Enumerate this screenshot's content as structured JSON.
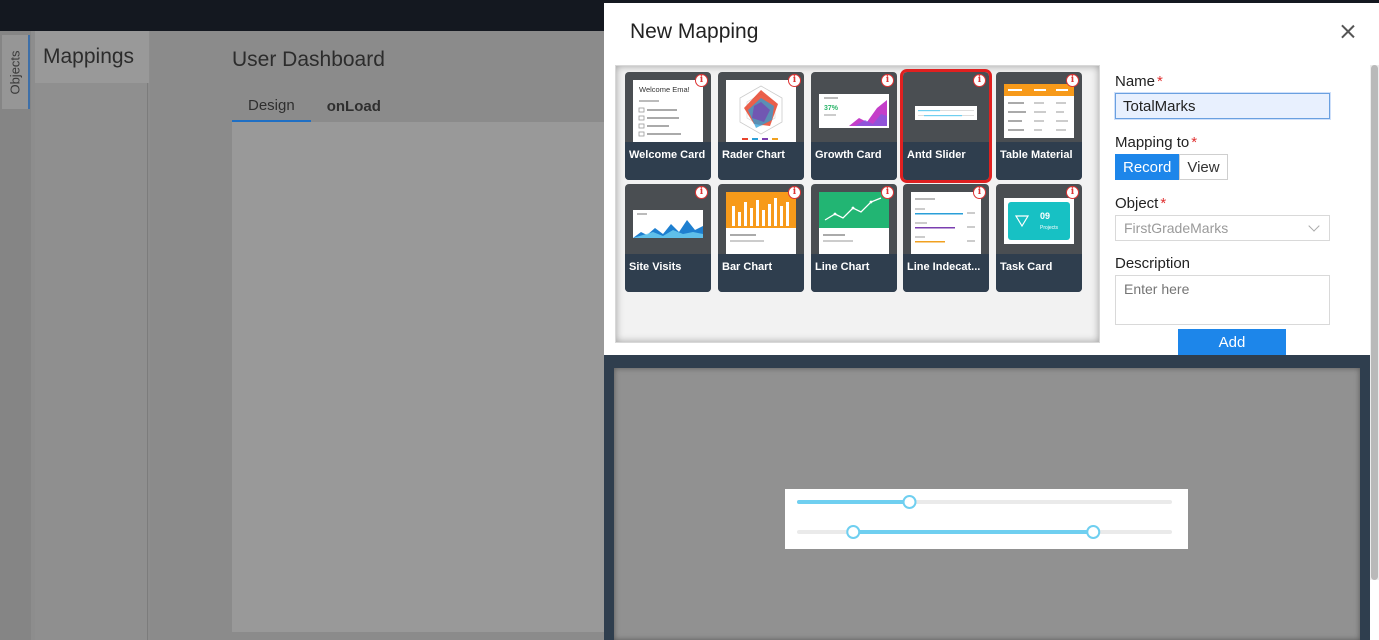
{
  "sidebar": {
    "tab_label": "Objects"
  },
  "panel": {
    "title": "Mappings"
  },
  "dashboard": {
    "title": "User Dashboard",
    "tabs": [
      {
        "label": "Design"
      },
      {
        "label": "onLoad"
      }
    ]
  },
  "modal": {
    "title": "New Mapping",
    "close_icon": "close-icon",
    "templates": [
      {
        "label": "Welcome Card",
        "thumb_title": "Welcome Ema!"
      },
      {
        "label": "Rader Chart"
      },
      {
        "label": "Growth Card",
        "thumb_value": "37%"
      },
      {
        "label": "Antd Slider",
        "selected": true
      },
      {
        "label": "Table Material"
      },
      {
        "label": "Site Visits"
      },
      {
        "label": "Bar Chart"
      },
      {
        "label": "Line Chart"
      },
      {
        "label": "Line Indecat..."
      },
      {
        "label": "Task Card",
        "thumb_value": "09",
        "thumb_sub": "Projects"
      }
    ],
    "form": {
      "name_label": "Name",
      "name_value": "TotalMarks",
      "mapping_label": "Mapping to",
      "mapping_options": [
        {
          "label": "Record",
          "selected": true
        },
        {
          "label": "View"
        }
      ],
      "object_label": "Object",
      "object_value": "FirstGradeMarks",
      "description_label": "Description",
      "description_placeholder": "Enter here",
      "required_mark": "*",
      "add_label": "Add"
    },
    "preview": {
      "single_slider_value": 0.3,
      "range_slider_values": [
        0.15,
        0.79
      ]
    }
  },
  "colors": {
    "accent": "#1d86ea",
    "selected_outline": "#e02020",
    "slider": "#6fcff0",
    "card_footer": "#2f3e4e"
  }
}
